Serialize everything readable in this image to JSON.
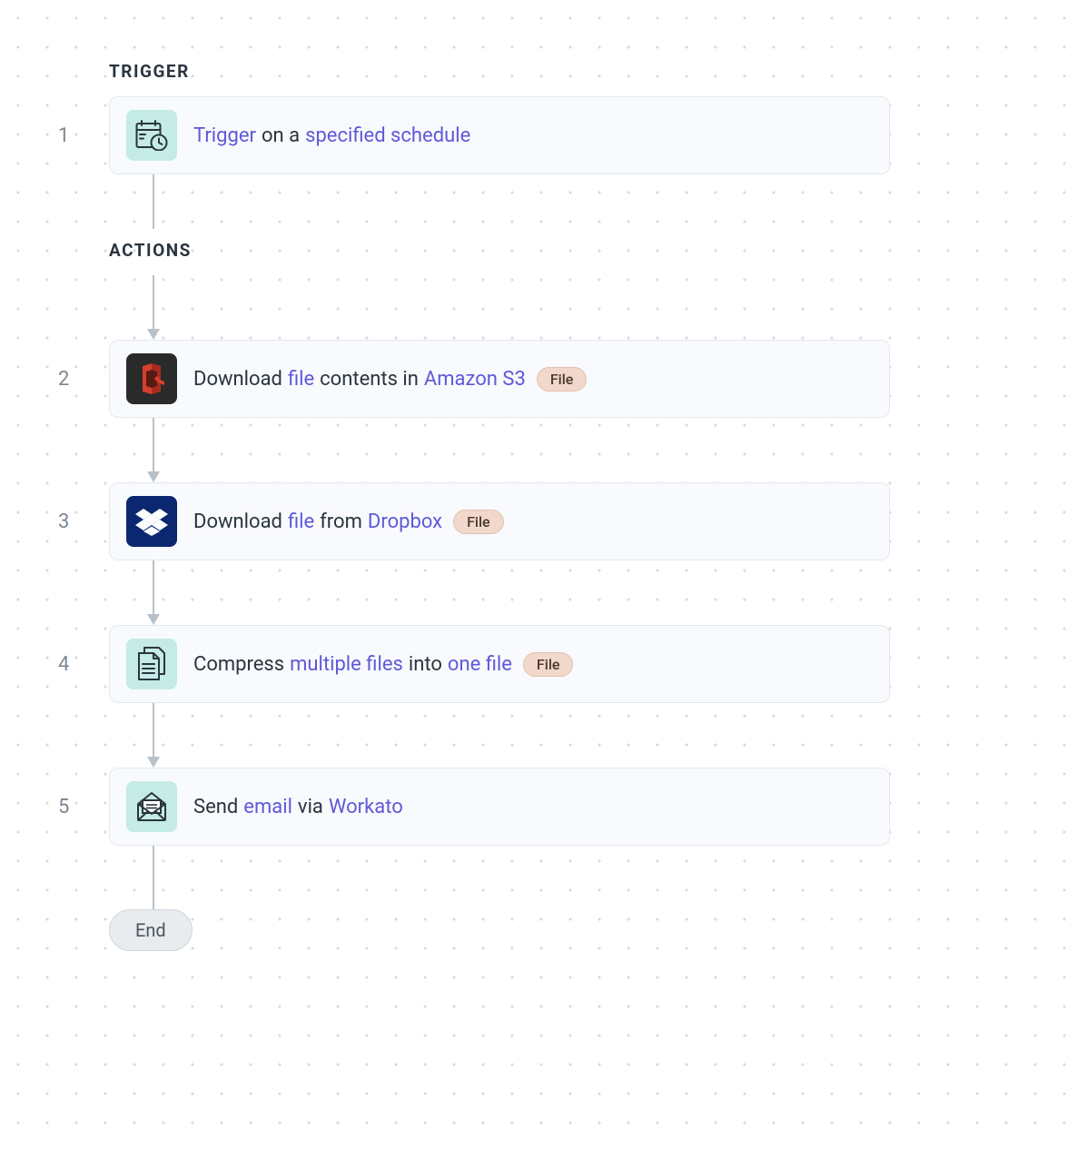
{
  "sections": {
    "trigger_label": "TRIGGER",
    "actions_label": "ACTIONS"
  },
  "steps": [
    {
      "num": "1",
      "icon": "schedule",
      "icon_bg": "teal",
      "parts": [
        {
          "t": "Trigger",
          "hl": true
        },
        {
          "t": " on a "
        },
        {
          "t": "specified schedule",
          "hl": true
        }
      ],
      "badge": null
    },
    {
      "num": "2",
      "icon": "s3",
      "icon_bg": "s3",
      "parts": [
        {
          "t": "Download "
        },
        {
          "t": "file",
          "hl": true
        },
        {
          "t": " contents in "
        },
        {
          "t": "Amazon S3",
          "hl": true
        }
      ],
      "badge": "File"
    },
    {
      "num": "3",
      "icon": "dropbox",
      "icon_bg": "dropbox",
      "parts": [
        {
          "t": "Download "
        },
        {
          "t": "file",
          "hl": true
        },
        {
          "t": " from "
        },
        {
          "t": "Dropbox",
          "hl": true
        }
      ],
      "badge": "File"
    },
    {
      "num": "4",
      "icon": "files",
      "icon_bg": "teal",
      "parts": [
        {
          "t": "Compress "
        },
        {
          "t": "multiple files",
          "hl": true
        },
        {
          "t": " into "
        },
        {
          "t": "one file",
          "hl": true
        }
      ],
      "badge": "File"
    },
    {
      "num": "5",
      "icon": "email",
      "icon_bg": "teal",
      "parts": [
        {
          "t": "Send "
        },
        {
          "t": "email",
          "hl": true
        },
        {
          "t": " via "
        },
        {
          "t": "Workato",
          "hl": true
        }
      ],
      "badge": null
    }
  ],
  "end_label": "End",
  "colors": {
    "highlight": "#5f59d8",
    "text": "#2a353f",
    "card_bg": "#f8fafd",
    "badge_bg": "#f1d8ca",
    "teal": "#c4ebe5"
  }
}
